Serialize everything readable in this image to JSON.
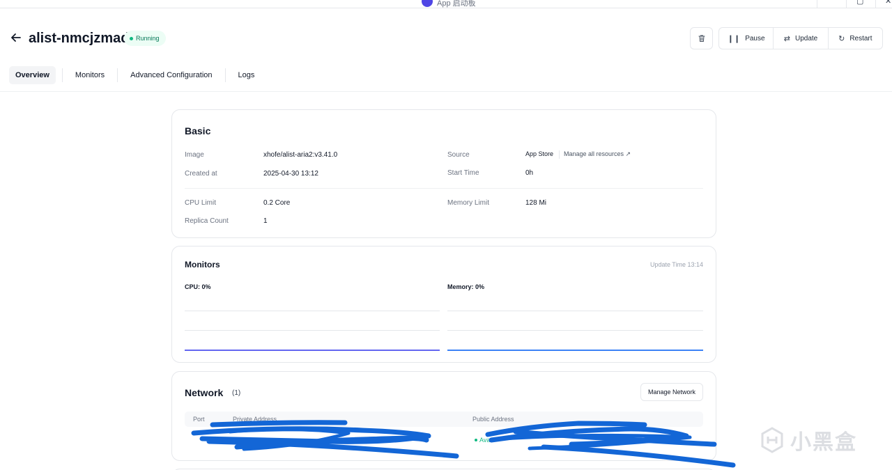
{
  "window": {
    "app_name": "App 启动板"
  },
  "header": {
    "title": "alist-nmcjzmad",
    "status": "Running",
    "actions": {
      "pause": "Pause",
      "update": "Update",
      "restart": "Restart"
    }
  },
  "tabs": [
    {
      "label": "Overview",
      "active": true
    },
    {
      "label": "Monitors",
      "active": false
    },
    {
      "label": "Advanced Configuration",
      "active": false
    },
    {
      "label": "Logs",
      "active": false
    }
  ],
  "basic": {
    "title": "Basic",
    "image_label": "Image",
    "image_value": "xhofe/alist-aria2:v3.41.0",
    "created_label": "Created at",
    "created_value": "2025-04-30 13:12",
    "source_label": "Source",
    "source_value": "App Store",
    "manage_link": "Manage all resources ↗",
    "start_label": "Start Time",
    "start_value": "0h",
    "cpu_label": "CPU Limit",
    "cpu_value": "0.2 Core",
    "memory_label": "Memory Limit",
    "memory_value": "128 Mi",
    "replica_label": "Replica Count",
    "replica_value": "1"
  },
  "monitors": {
    "title": "Monitors",
    "update_time": "Update Time  13:14",
    "cpu_label": "CPU:  0%",
    "memory_label": "Memory:  0%",
    "cpu_line_color": "#6366f1",
    "memory_line_color": "#3b82f6"
  },
  "network": {
    "title": "Network",
    "count": "(1)",
    "manage_button": "Manage Network",
    "columns": {
      "port": "Port",
      "private": "Private Address",
      "public": "Public Address"
    },
    "public_status": "Avai"
  },
  "watermark": {
    "text": "小黑盒"
  }
}
